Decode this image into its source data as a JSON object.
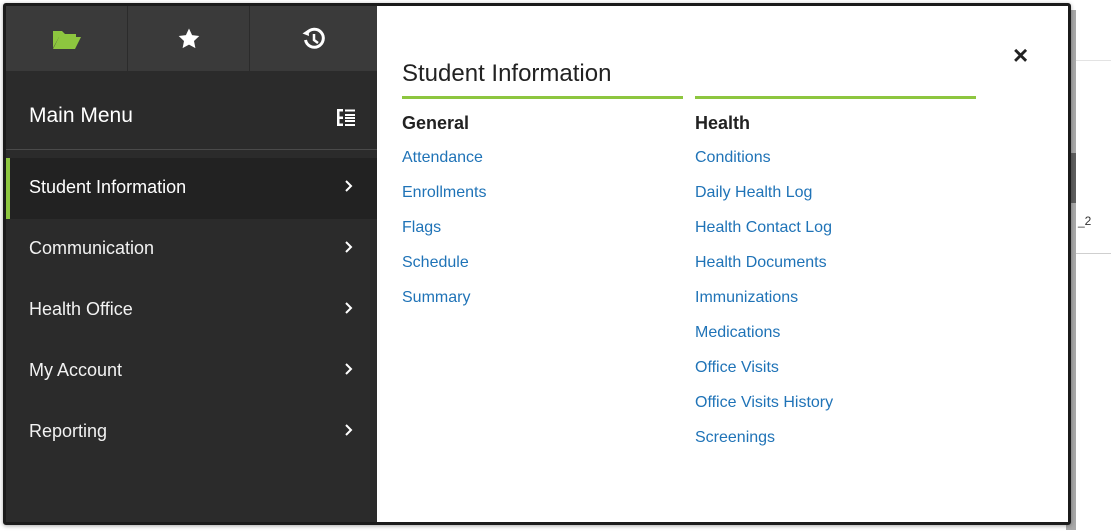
{
  "tabs": [
    {
      "name": "folder-icon",
      "color": "#8dc63f"
    },
    {
      "name": "star-icon"
    },
    {
      "name": "history-icon"
    }
  ],
  "sidebar": {
    "title": "Main Menu",
    "items": [
      {
        "label": "Student Information",
        "active": true
      },
      {
        "label": "Communication"
      },
      {
        "label": "Health Office"
      },
      {
        "label": "My Account"
      },
      {
        "label": "Reporting"
      }
    ]
  },
  "panel": {
    "title": "Student Information",
    "close_label": "×",
    "general": {
      "heading": "General",
      "links": [
        "Attendance",
        "Enrollments",
        "Flags",
        "Schedule",
        "Summary"
      ]
    },
    "health": {
      "heading": "Health",
      "links": [
        "Conditions",
        "Daily Health Log",
        "Health Contact Log",
        "Health Documents",
        "Immunizations",
        "Medications",
        "Office Visits",
        "Office Visits History",
        "Screenings"
      ]
    }
  },
  "background": {
    "fragment": "_2"
  },
  "colors": {
    "accent": "#8dc63f",
    "link": "#1f73b7",
    "sidebar": "#2b2b2b"
  }
}
